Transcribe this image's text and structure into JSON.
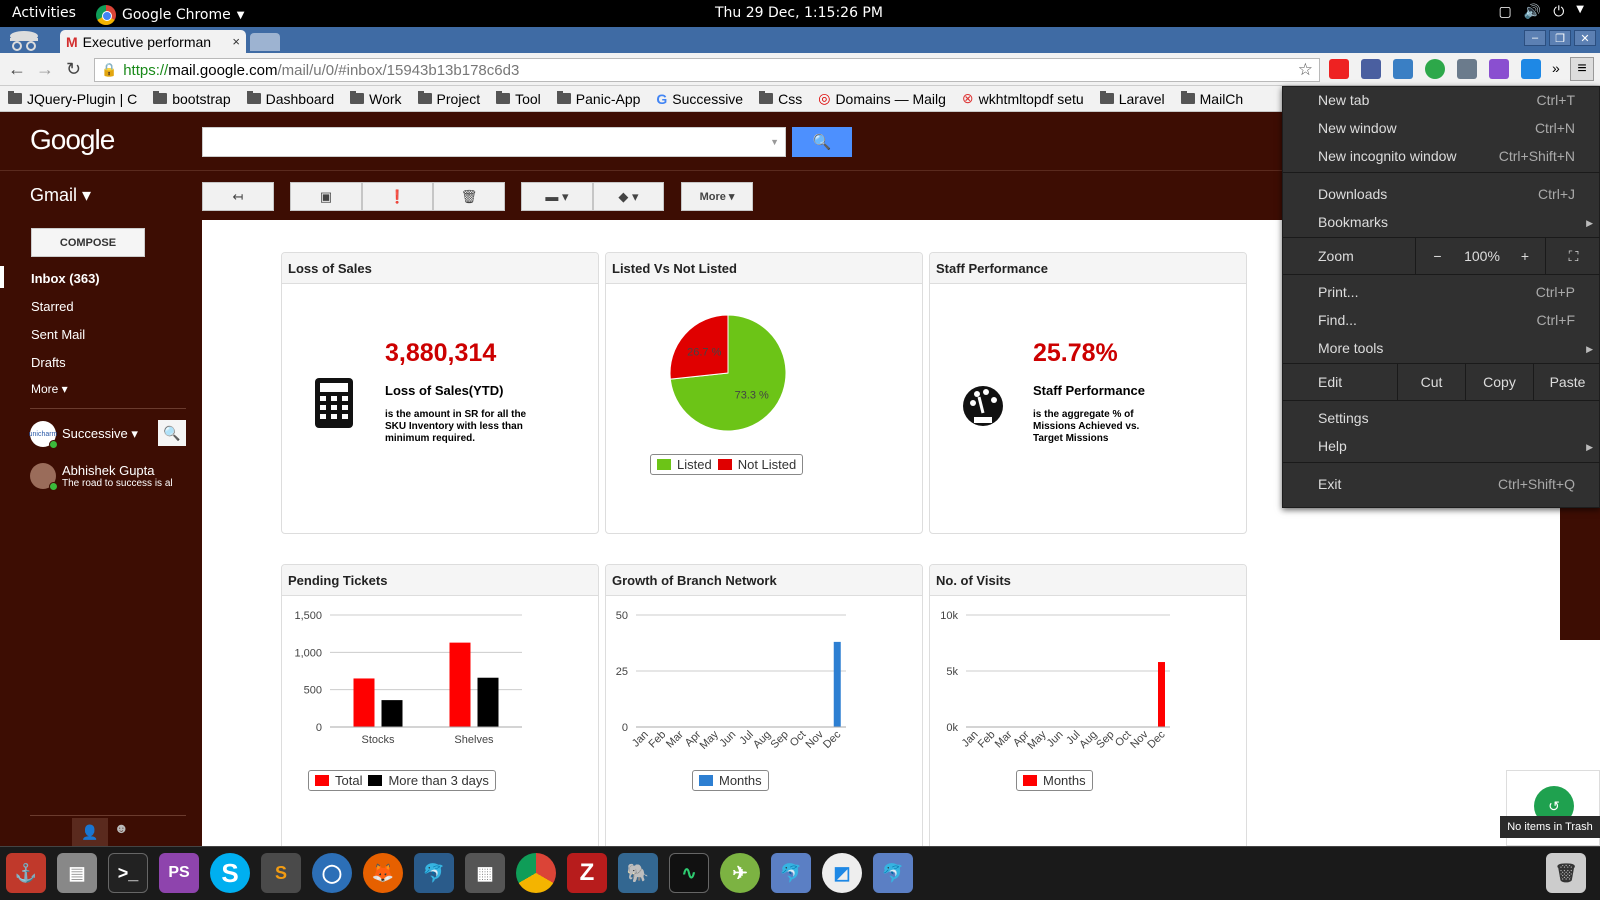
{
  "topbar": {
    "activities": "Activities",
    "app": "Google Chrome",
    "clock": "Thu 29 Dec,  1:15:26 PM"
  },
  "tab": {
    "title": "Executive performan",
    "close": "×"
  },
  "address": {
    "https": "https://",
    "host": "mail.google.com",
    "path": "/mail/u/0/#inbox/15943b13b178c6d3"
  },
  "bookmarks": [
    "JQuery-Plugin | C",
    "bootstrap",
    "Dashboard",
    "Work",
    "Project",
    "Tool",
    "Panic-App",
    "Successive",
    "Css",
    "Domains — Mailg",
    "wkhtmltopdf setu",
    "Laravel",
    "MailCh"
  ],
  "gmail": {
    "logo": "Google",
    "label": "Gmail ▾",
    "more_btn": "More ▾",
    "compose": "COMPOSE",
    "nav": [
      "Inbox (363)",
      "Starred",
      "Sent Mail",
      "Drafts",
      "More ▾"
    ],
    "account": "Successive ▾",
    "account_avatar": "unicharm",
    "contact_name": "Abhishek Gupta",
    "contact_status": "The road to success is al"
  },
  "cards": {
    "loss": {
      "title": "Loss of Sales",
      "value": "3,880,314",
      "label": "Loss of Sales(YTD)",
      "desc": "is the amount in SR for all the SKU Inventory with less than minimum required."
    },
    "listed": {
      "title": "Listed Vs Not Listed",
      "legend": [
        "Listed",
        "Not Listed"
      ]
    },
    "staff": {
      "title": "Staff Performance",
      "value": "25.78%",
      "label": "Staff Performance",
      "desc": "is the aggregate % of Missions Achieved vs. Target Missions"
    },
    "pending": {
      "title": "Pending Tickets",
      "legend": [
        "Total",
        "More than 3 days"
      ]
    },
    "growth": {
      "title": "Growth of Branch Network",
      "legend": [
        "Months"
      ]
    },
    "visits": {
      "title": "No. of Visits",
      "legend": [
        "Months"
      ]
    }
  },
  "chart_data": [
    {
      "type": "pie",
      "categories": [
        "Listed",
        "Not Listed"
      ],
      "values": [
        73.3,
        26.7
      ],
      "labels": [
        "73.3 %",
        "26.7 %"
      ],
      "colors": [
        "#6cc417",
        "#e00000"
      ]
    },
    {
      "type": "bar",
      "categories": [
        "Stocks",
        "Shelves"
      ],
      "series": [
        {
          "name": "Total",
          "values": [
            650,
            1130
          ],
          "color": "#ff0000"
        },
        {
          "name": "More than 3 days",
          "values": [
            360,
            660
          ],
          "color": "#000000"
        }
      ],
      "yticks": [
        "0",
        "500",
        "1,000",
        "1,500"
      ],
      "ylim": [
        0,
        1500
      ]
    },
    {
      "type": "bar",
      "categories": [
        "Jan",
        "Feb",
        "Mar",
        "Apr",
        "May",
        "Jun",
        "Jul",
        "Aug",
        "Sep",
        "Oct",
        "Nov",
        "Dec"
      ],
      "series": [
        {
          "name": "Months",
          "values": [
            0,
            0,
            0,
            0,
            0,
            0,
            0,
            0,
            0,
            0,
            0,
            38
          ],
          "color": "#2d7fd2"
        }
      ],
      "yticks": [
        "0",
        "25",
        "50"
      ],
      "ylim": [
        0,
        50
      ]
    },
    {
      "type": "bar",
      "categories": [
        "Jan",
        "Feb",
        "Mar",
        "Apr",
        "May",
        "Jun",
        "Jul",
        "Aug",
        "Sep",
        "Oct",
        "Nov",
        "Dec"
      ],
      "series": [
        {
          "name": "Months",
          "values": [
            0,
            0,
            0,
            0,
            0,
            0,
            0,
            0,
            0,
            0,
            0,
            5800
          ],
          "color": "#ff0000"
        }
      ],
      "yticks": [
        "0k",
        "5k",
        "10k"
      ],
      "ylim": [
        0,
        10000
      ]
    }
  ],
  "menu": {
    "items": [
      {
        "label": "New tab",
        "shortcut": "Ctrl+T"
      },
      {
        "label": "New window",
        "shortcut": "Ctrl+N"
      },
      {
        "label": "New incognito window",
        "shortcut": "Ctrl+Shift+N"
      },
      {
        "label": "Downloads",
        "shortcut": "Ctrl+J"
      },
      {
        "label": "Bookmarks",
        "shortcut": ""
      },
      {
        "label": "Print...",
        "shortcut": "Ctrl+P"
      },
      {
        "label": "Find...",
        "shortcut": "Ctrl+F"
      },
      {
        "label": "More tools",
        "shortcut": ""
      },
      {
        "label": "Settings",
        "shortcut": ""
      },
      {
        "label": "Help",
        "shortcut": ""
      },
      {
        "label": "Exit",
        "shortcut": "Ctrl+Shift+Q"
      }
    ],
    "zoom": {
      "label": "Zoom",
      "minus": "−",
      "value": "100%",
      "plus": "+"
    },
    "edit": {
      "label": "Edit",
      "cut": "Cut",
      "copy": "Copy",
      "paste": "Paste"
    }
  },
  "trash": {
    "tooltip": "No items in Trash"
  },
  "dock": [
    "anchor",
    "files",
    "terminal",
    "PS",
    "S",
    "sublime",
    "chat",
    "firefox",
    "mysql",
    "calculator",
    "chrome",
    "filezilla",
    "postgres",
    "monitor",
    "app",
    "dolphin",
    "stash",
    "dolphin2"
  ]
}
